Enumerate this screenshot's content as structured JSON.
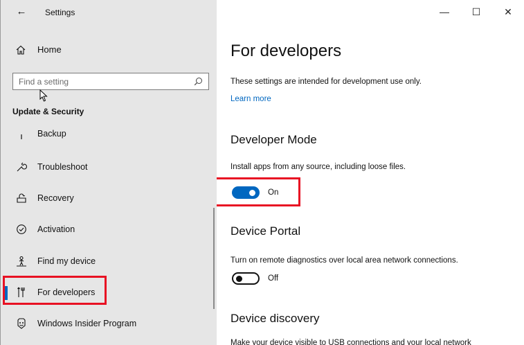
{
  "window": {
    "title": "Settings",
    "back_glyph": "←",
    "minimize_glyph": "—",
    "maximize_glyph": "☐",
    "close_glyph": "✕"
  },
  "sidebar": {
    "home_label": "Home",
    "search_placeholder": "Find a setting",
    "section_title": "Update & Security",
    "items": [
      {
        "label": "Backup",
        "icon": "backup-icon"
      },
      {
        "label": "Troubleshoot",
        "icon": "wrench-icon"
      },
      {
        "label": "Recovery",
        "icon": "recovery-icon"
      },
      {
        "label": "Activation",
        "icon": "check-circle-icon"
      },
      {
        "label": "Find my device",
        "icon": "person-location-icon"
      },
      {
        "label": "For developers",
        "icon": "developer-tools-icon",
        "active": true
      },
      {
        "label": "Windows Insider Program",
        "icon": "insider-icon"
      }
    ]
  },
  "main": {
    "title": "For developers",
    "intro": "These settings are intended for development use only.",
    "learn_more": "Learn more",
    "developer_mode": {
      "heading": "Developer Mode",
      "description": "Install apps from any source, including loose files.",
      "state": "On"
    },
    "device_portal": {
      "heading": "Device Portal",
      "description": "Turn on remote diagnostics over local area network connections.",
      "state": "Off"
    },
    "device_discovery": {
      "heading": "Device discovery",
      "description": "Make your device visible to USB connections and your local network"
    }
  },
  "colors": {
    "accent": "#0067c0",
    "highlight": "#e81123",
    "sidebar_bg": "#e6e6e6"
  }
}
